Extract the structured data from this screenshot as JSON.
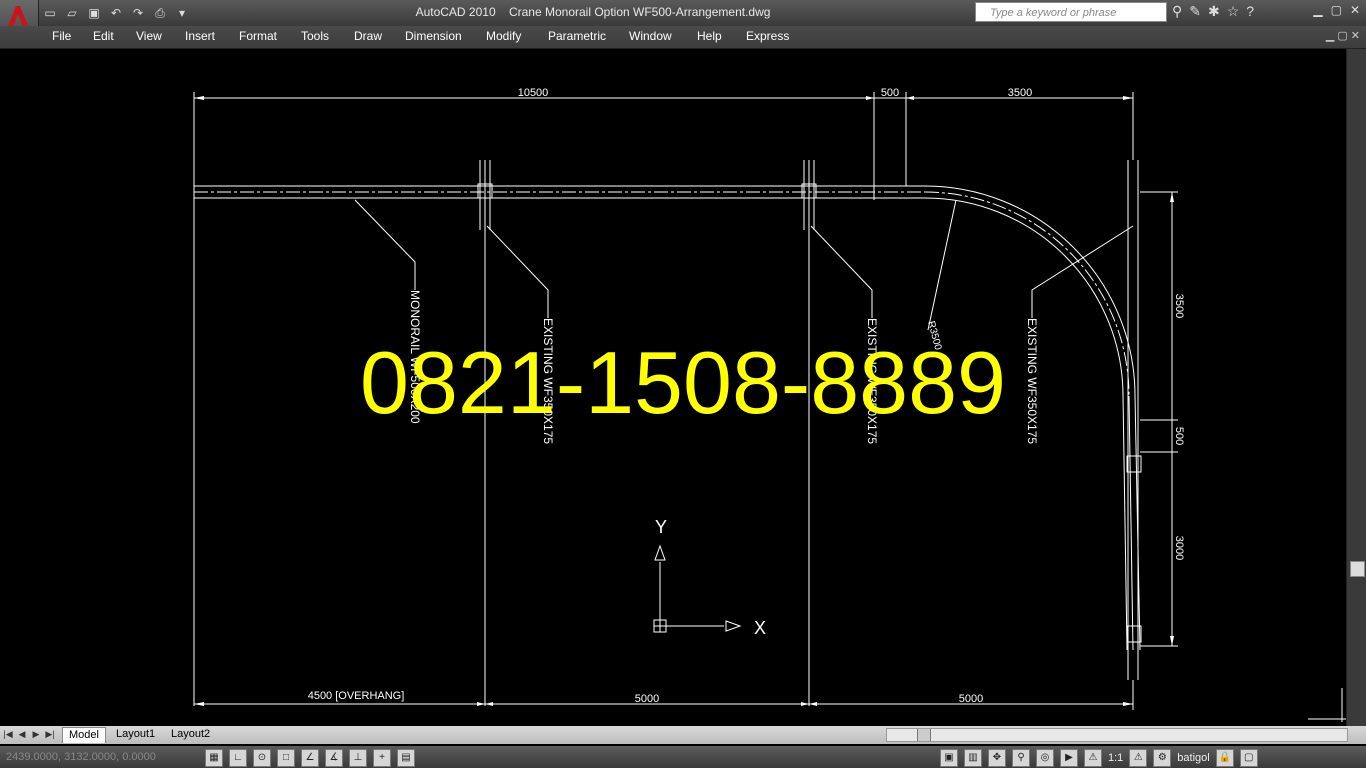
{
  "app": {
    "app_name": "AutoCAD 2010",
    "document": "Crane Monorail Option WF500-Arrangement.dwg",
    "search_placeholder": "Type a keyword or phrase"
  },
  "menu": [
    "File",
    "Edit",
    "View",
    "Insert",
    "Format",
    "Tools",
    "Draw",
    "Dimension",
    "Modify",
    "Parametric",
    "Window",
    "Help",
    "Express"
  ],
  "drawing": {
    "dim_top": [
      "10500",
      "500",
      "3500"
    ],
    "dim_bottom": [
      "4500 [OVERHANG]",
      "5000",
      "5000"
    ],
    "dim_right": [
      "3500",
      "500",
      "3000"
    ],
    "labels": {
      "monorail": "MONORAIL WF500X200",
      "existing1": "EXISTING WF350X175",
      "existing2": "EXISTING WF350X175",
      "existing3": "EXISTING WF350X175",
      "radius": "R3500"
    },
    "ucs_x": "X",
    "ucs_y": "Y",
    "watermark": "0821-1508-8889",
    "watermark_color": "#ffff00"
  },
  "tabs": [
    "Model",
    "Layout1",
    "Layout2"
  ],
  "status": {
    "coords": "2439.0000, 3132.0000, 0.0000",
    "scale": "1:1",
    "workspace": "batigol"
  }
}
